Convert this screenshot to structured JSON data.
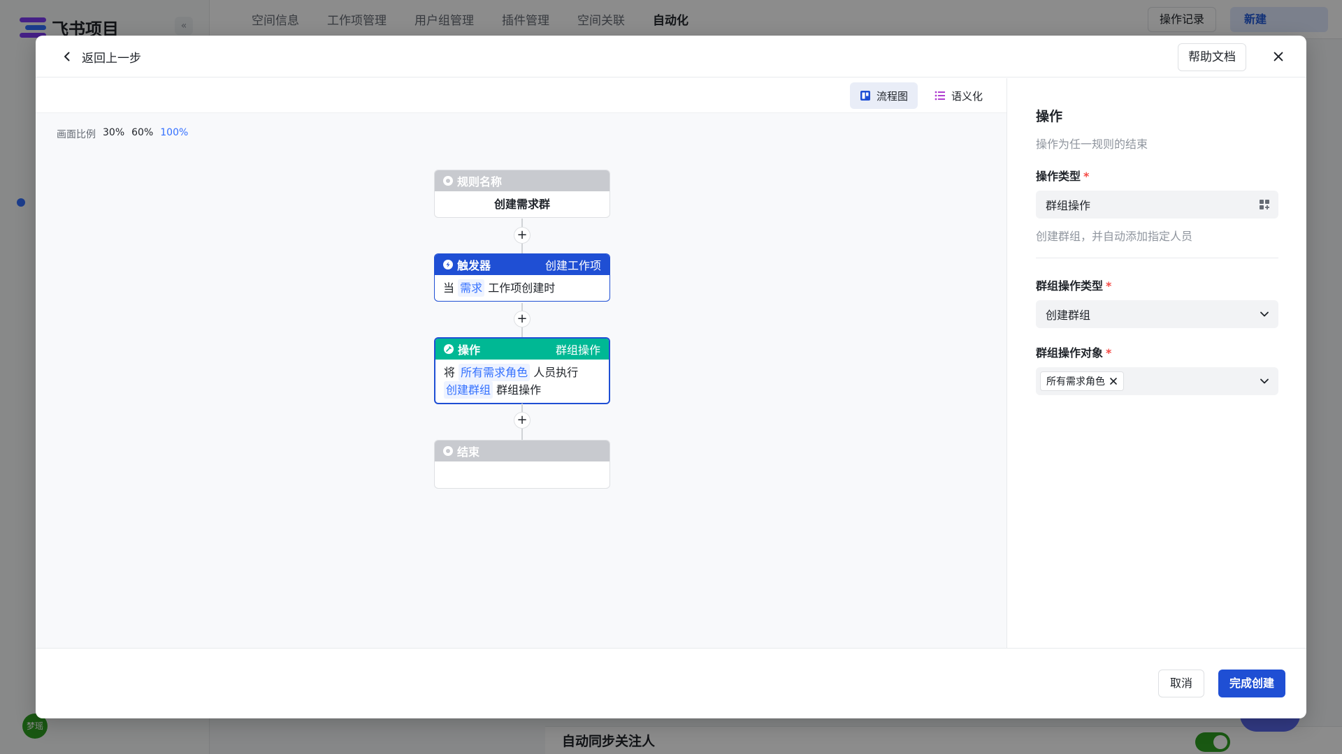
{
  "background": {
    "app_name": "飞书项目",
    "collapse_glyph": "«",
    "nav_tabs": [
      "空间信息",
      "工作项管理",
      "用户组管理",
      "插件管理",
      "空间关联",
      "自动化"
    ],
    "active_tab": "自动化",
    "op_log_label": "操作记录",
    "new_label": "新建",
    "avatar_text": "梦瑶",
    "bottom_row_title": "自动同步关注人"
  },
  "modal": {
    "back_label": "返回上一步",
    "help_label": "帮助文档",
    "view_switch": {
      "flowchart_label": "流程图",
      "semantic_label": "语义化"
    },
    "zoom": {
      "label": "画面比例",
      "options": [
        "30%",
        "60%",
        "100%"
      ],
      "active": "100%"
    },
    "flow": {
      "rule": {
        "title": "规则名称",
        "body": "创建需求群"
      },
      "trigger": {
        "title": "触发器",
        "right": "创建工作项",
        "body_prefix": "当",
        "body_chip": "需求",
        "body_suffix": "工作项创建时"
      },
      "action": {
        "title": "操作",
        "right": "群组操作",
        "line1_prefix": "将",
        "line1_chip": "所有需求角色",
        "line1_suffix": "人员执行",
        "line2_chip": "创建群组",
        "line2_suffix": "群组操作"
      },
      "end": {
        "title": "结束"
      },
      "plus_glyph": "+"
    },
    "panel": {
      "title": "操作",
      "desc": "操作为任一规则的结束",
      "op_type_label": "操作类型",
      "op_type_value": "群组操作",
      "op_type_hint": "创建群组，并自动添加指定人员",
      "group_op_type_label": "群组操作类型",
      "group_op_type_value": "创建群组",
      "group_op_target_label": "群组操作对象",
      "group_op_target_tag": "所有需求角色",
      "required_mark": "*"
    },
    "footer": {
      "cancel_label": "取消",
      "submit_label": "完成创建"
    }
  },
  "colors": {
    "primary": "#1f4fd4",
    "action_green": "#00b894",
    "required_red": "#f54a45"
  }
}
